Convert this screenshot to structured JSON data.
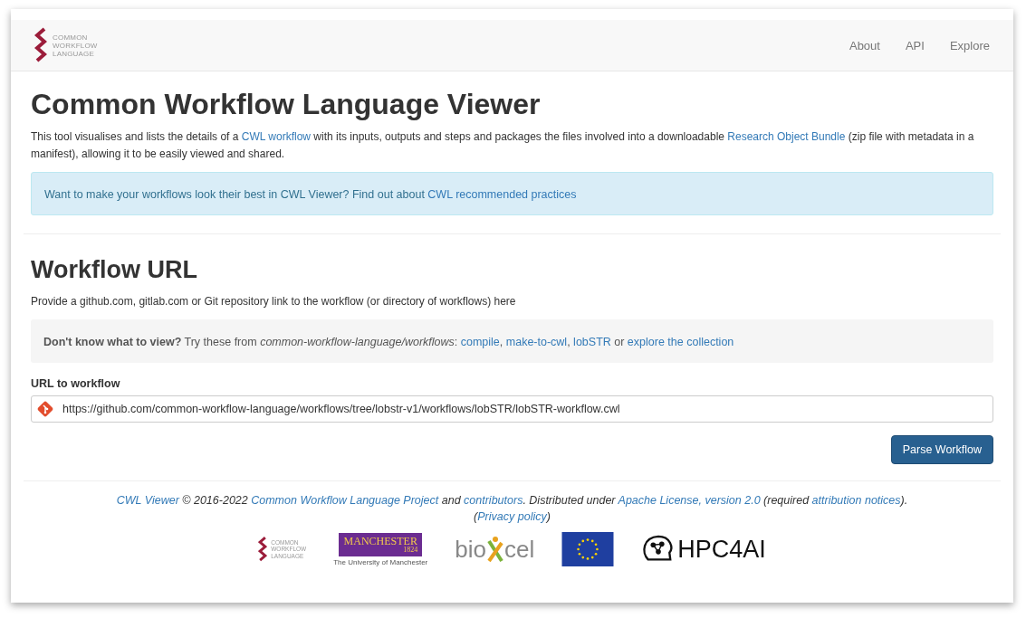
{
  "navbar": {
    "logo_text": [
      "COMMON",
      "WORKFLOW",
      "LANGUAGE"
    ],
    "links": [
      "About",
      "API",
      "Explore"
    ]
  },
  "title": "Common Workflow Language Viewer",
  "intro": [
    {
      "kind": "text",
      "text": "This tool visualises and lists the details of a "
    },
    {
      "kind": "link",
      "text": "CWL workflow"
    },
    {
      "kind": "text",
      "text": " with its inputs, outputs and steps and packages the files involved into a downloadable "
    },
    {
      "kind": "link",
      "text": "Research Object Bundle"
    },
    {
      "kind": "text",
      "text": " (zip file with metadata in a manifest), allowing it to be easily viewed and shared."
    }
  ],
  "alert": [
    {
      "kind": "text",
      "text": "Want to make your workflows look their best in CWL Viewer? Find out about "
    },
    {
      "kind": "link",
      "text": "CWL recommended practices"
    }
  ],
  "section_title": "Workflow URL",
  "section_text": "Provide a github.com, gitlab.com or Git repository link to the workflow (or directory of workflows) here",
  "suggestions": [
    {
      "kind": "bold",
      "text": "Don't know what to view?"
    },
    {
      "kind": "text",
      "text": " Try these from "
    },
    {
      "kind": "italic",
      "text": "common-workflow-language/workflows"
    },
    {
      "kind": "text",
      "text": ": "
    },
    {
      "kind": "link",
      "text": "compile"
    },
    {
      "kind": "text",
      "text": ", "
    },
    {
      "kind": "link",
      "text": "make-to-cwl"
    },
    {
      "kind": "text",
      "text": ", "
    },
    {
      "kind": "link",
      "text": "lobSTR"
    },
    {
      "kind": "text",
      "text": " or "
    },
    {
      "kind": "link",
      "text": "explore the collection"
    }
  ],
  "url_field": {
    "label": "URL to workflow",
    "value": "https://github.com/common-workflow-language/workflows/tree/lobstr-v1/workflows/lobSTR/lobSTR-workflow.cwl"
  },
  "submit_button": "Parse Workflow",
  "footer": {
    "line1": [
      {
        "kind": "link",
        "text": "CWL Viewer"
      },
      {
        "kind": "text",
        "text": " © 2016-2022 "
      },
      {
        "kind": "link",
        "text": "Common Workflow Language Project"
      },
      {
        "kind": "text",
        "text": " and "
      },
      {
        "kind": "link",
        "text": "contributors"
      },
      {
        "kind": "text",
        "text": ". Distributed under "
      },
      {
        "kind": "link",
        "text": "Apache License, version 2.0"
      },
      {
        "kind": "text",
        "text": " (required "
      },
      {
        "kind": "link",
        "text": "attribution notices"
      },
      {
        "kind": "text",
        "text": ")."
      }
    ],
    "line2": [
      {
        "kind": "text",
        "text": "("
      },
      {
        "kind": "link",
        "text": "Privacy policy"
      },
      {
        "kind": "text",
        "text": ")"
      }
    ],
    "logos": [
      {
        "kind": "cwl",
        "texts": [
          "COMMON",
          "WORKFLOW",
          "LANGUAGE"
        ]
      },
      {
        "kind": "manchester",
        "texts": [
          "MANCHESTER",
          "1824",
          "The University of Manchester"
        ]
      },
      {
        "kind": "bioexcel",
        "texts": [
          "bio",
          "cel"
        ]
      },
      {
        "kind": "eu"
      },
      {
        "kind": "hpc",
        "texts": [
          "HPC4AI"
        ]
      }
    ]
  }
}
